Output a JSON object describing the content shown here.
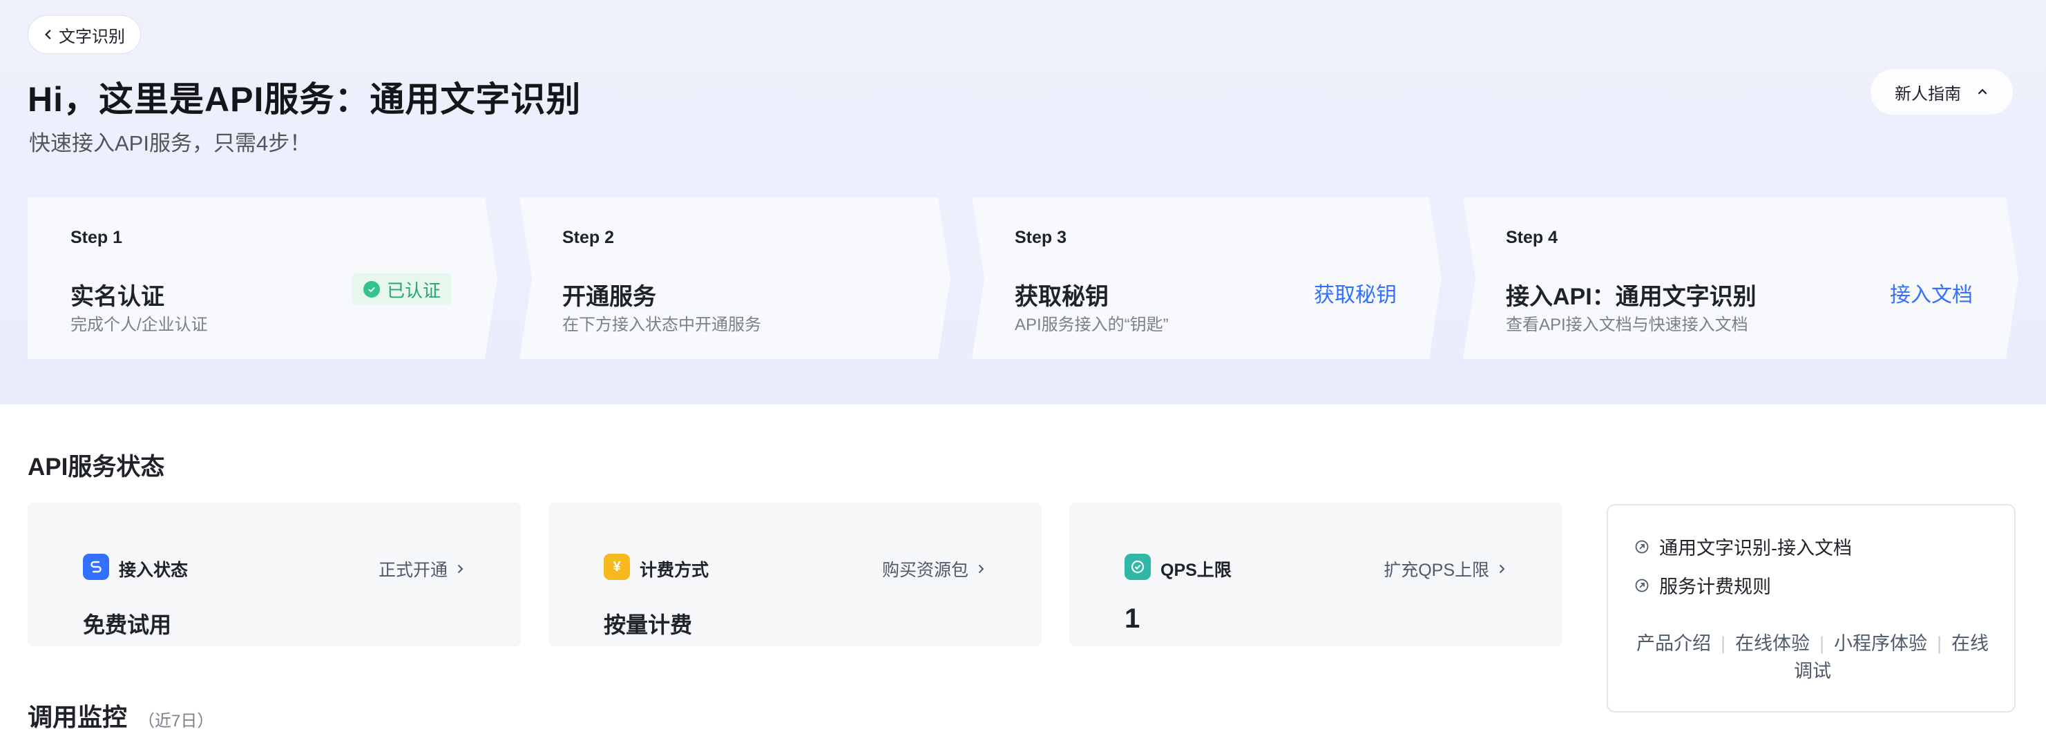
{
  "header": {
    "back_label": "文字识别",
    "title": "Hi，这里是API服务：通用文字识别",
    "subtitle": "快速接入API服务，只需4步！",
    "guide_label": "新人指南"
  },
  "steps": [
    {
      "step": "Step 1",
      "title": "实名认证",
      "desc": "完成个人/企业认证",
      "badge": "已认证"
    },
    {
      "step": "Step 2",
      "title": "开通服务",
      "desc": "在下方接入状态中开通服务"
    },
    {
      "step": "Step 3",
      "title": "获取秘钥",
      "desc": "API服务接入的“钥匙”",
      "action": "获取秘钥"
    },
    {
      "step": "Step 4",
      "title": "接入API：通用文字识别",
      "desc": "查看API接入文档与快速接入文档",
      "action": "接入文档"
    }
  ],
  "status": {
    "section_title": "API服务状态",
    "cards": [
      {
        "label": "接入状态",
        "link": "正式开通",
        "value": "免费试用",
        "icon": "access-icon",
        "icon_color": "#3370ff"
      },
      {
        "label": "计费方式",
        "link": "购买资源包",
        "value": "按量计费",
        "icon": "yen-icon",
        "icon_glyph": "¥",
        "icon_color": "#f7ba1e"
      },
      {
        "label": "QPS上限",
        "link": "扩充QPS上限",
        "value": "1",
        "icon": "qps-icon",
        "icon_color": "#2fb8a6"
      }
    ]
  },
  "docs": {
    "links": [
      "通用文字识别-接入文档",
      "服务计费规则"
    ],
    "quick": [
      "产品介绍",
      "在线体验",
      "小程序体验",
      "在线调试"
    ]
  },
  "monitor": {
    "title": "调用监控",
    "subtitle": "（近7日）"
  }
}
